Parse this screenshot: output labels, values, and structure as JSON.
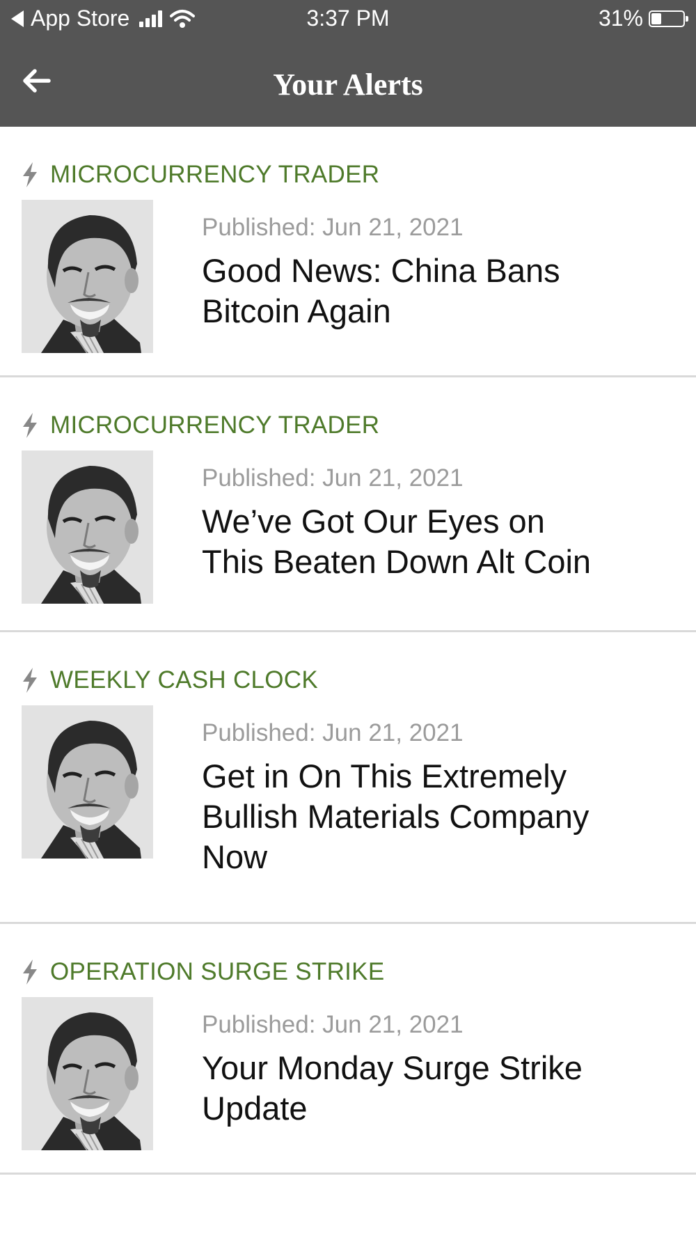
{
  "status_bar": {
    "back_app": "App Store",
    "time": "3:37 PM",
    "battery_pct_label": "31%",
    "battery_level": 0.31
  },
  "nav": {
    "title": "Your Alerts",
    "back_icon": "back-arrow-icon"
  },
  "colors": {
    "header_bg": "#555555",
    "category_green": "#4e7a2a",
    "date_gray": "#9b9b9b",
    "divider": "#d9d9d9"
  },
  "alerts": [
    {
      "category": "MICROCURRENCY TRADER",
      "published": "Published: Jun 21, 2021",
      "headline": "Good News: China Bans Bitcoin Again"
    },
    {
      "category": "MICROCURRENCY TRADER",
      "published": "Published: Jun 21, 2021",
      "headline": "We’ve Got Our Eyes on This Beaten Down Alt Coin"
    },
    {
      "category": "WEEKLY CASH CLOCK",
      "published": "Published: Jun 21, 2021",
      "headline": "Get in On This Extremely Bullish Materials Company Now"
    },
    {
      "category": "OPERATION SURGE STRIKE",
      "published": "Published: Jun 21, 2021",
      "headline": "Your Monday Surge Strike Update"
    }
  ]
}
